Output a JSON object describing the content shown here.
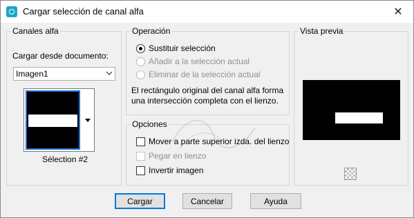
{
  "window": {
    "title": "Cargar selección de canal alfa",
    "icon": "app-icon",
    "close_glyph": "✕"
  },
  "canales": {
    "legend": "Canales alfa",
    "load_label": "Cargar desde documento:",
    "document_value": "Imagen1",
    "thumb_caption": "Sélection #2"
  },
  "operacion": {
    "legend": "Operación",
    "options": [
      {
        "label": "Sustituir selección",
        "checked": true,
        "disabled": false
      },
      {
        "label": "Añadir a la selección actual",
        "checked": false,
        "disabled": true
      },
      {
        "label": "Eliminar de la selección actual",
        "checked": false,
        "disabled": true
      }
    ],
    "description": "El rectángulo original del canal alfa forma una intersección completa con el lienzo."
  },
  "opciones": {
    "legend": "Opciones",
    "items": [
      {
        "label": "Mover a parte superior izda. del lienzo",
        "checked": false,
        "disabled": false
      },
      {
        "label": "Pegar en lienzo",
        "checked": false,
        "disabled": true
      },
      {
        "label": "Invertir imagen",
        "checked": false,
        "disabled": false
      }
    ]
  },
  "vista": {
    "legend": "Vista previa",
    "background_icon": "checkerboard-icon"
  },
  "buttons": {
    "ok": "Cargar",
    "cancel": "Cancelar",
    "help": "Ayuda"
  },
  "colors": {
    "accent": "#0078d7",
    "title_icon": "#1aa7c7"
  }
}
